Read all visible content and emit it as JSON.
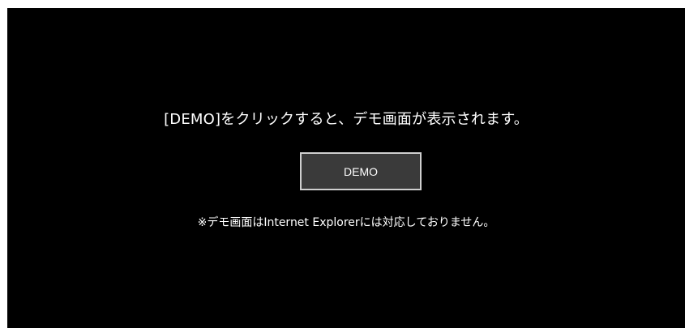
{
  "panel": {
    "background": "#000000",
    "instruction": "[DEMO]をクリックすると、デモ画面が表示されます。",
    "demo_button_label": "DEMO",
    "note": "※デモ画面はInternet Explorerには対応しておりません。"
  },
  "colors": {
    "text": "#ffffff",
    "button_bg": "#3a3a3a",
    "button_border": "#cfcfcf"
  }
}
